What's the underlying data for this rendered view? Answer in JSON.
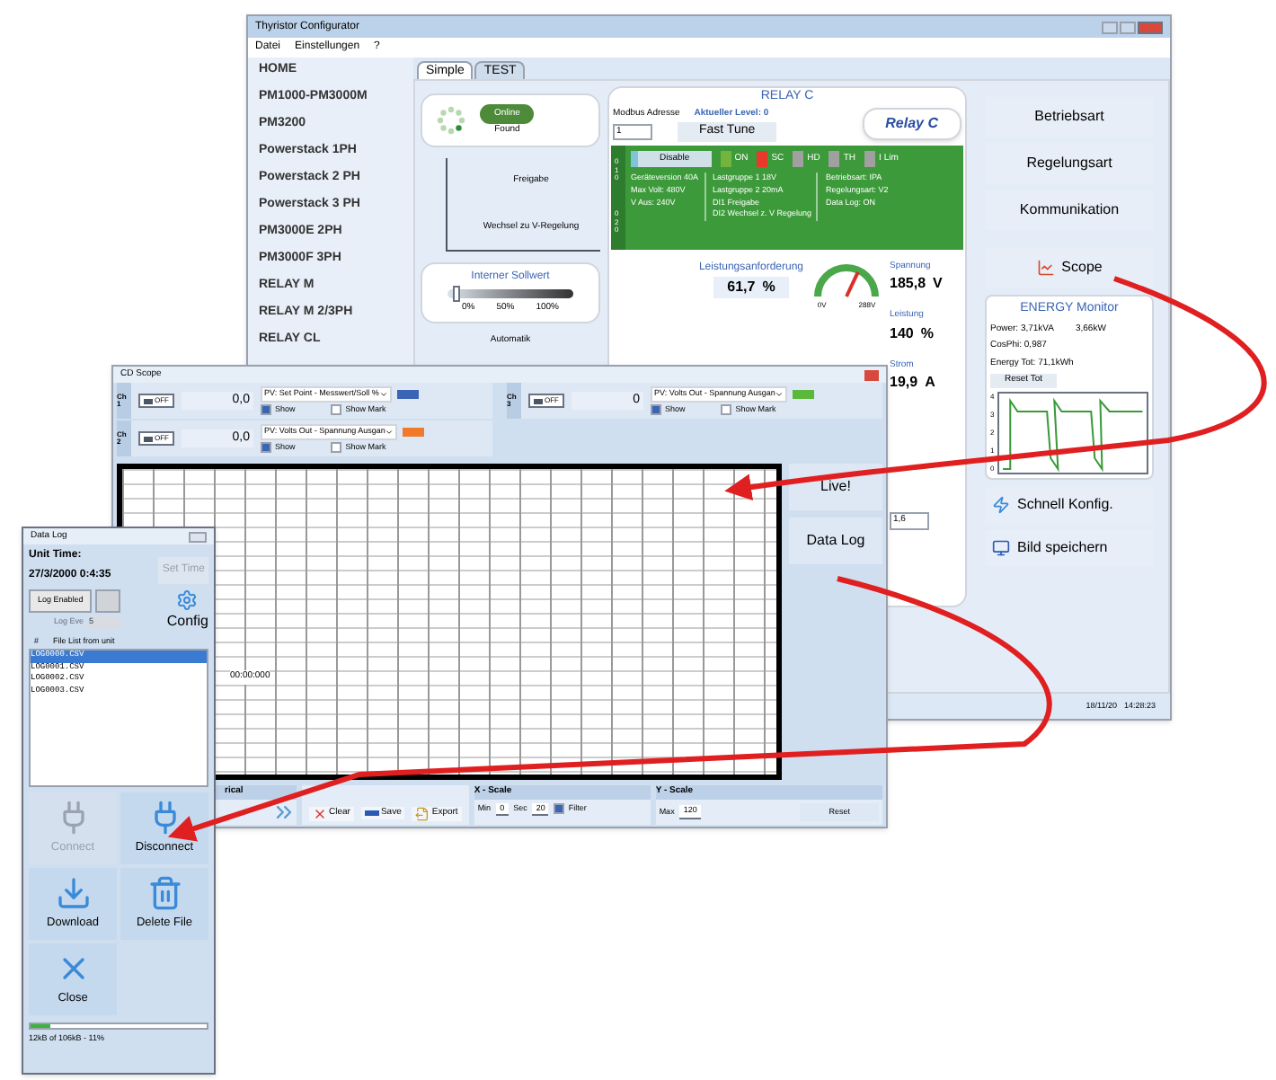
{
  "main_window": {
    "title": "Thyristor Configurator",
    "menu": [
      "Datei",
      "Einstellungen",
      "?"
    ],
    "sidebar": [
      "HOME",
      "PM1000-PM3000M",
      "PM3200",
      "Powerstack 1PH",
      "Powerstack 2 PH",
      "Powerstack 3 PH",
      "PM3000E 2PH",
      "PM3000F 3PH",
      "RELAY M",
      "RELAY M 2/3PH",
      "RELAY CL"
    ],
    "tabs": [
      {
        "label": "Simple",
        "selected": true
      },
      {
        "label": "TEST",
        "selected": false
      }
    ],
    "connection": {
      "label": "Online",
      "caption": "Found"
    },
    "diagram": [
      "Freigabe",
      "Wechsel zu V-Regelung",
      "Automatik"
    ],
    "setpoint": {
      "title": "Interner Sollwert",
      "level": 0.04,
      "ticks": [
        "0%",
        "50%",
        "100%"
      ]
    },
    "relay": {
      "title": "RELAY C",
      "modbus_label": "Modbus Adresse",
      "modbus_value": "1",
      "level_label": "Aktueller Level: 0",
      "tune_button": "Fast Tune",
      "logo": "Relay C",
      "disable_button": "Disable",
      "indicators": [
        {
          "label": "ON",
          "color": "#74b43c"
        },
        {
          "label": "SC",
          "color": "#e8392a"
        },
        {
          "label": "HD",
          "color": "#a0a0a0"
        },
        {
          "label": "TH",
          "color": "#a0a0a0"
        },
        {
          "label": "I Lim",
          "color": "#a0a0a0"
        }
      ],
      "side_tabs": [
        "010",
        "020"
      ],
      "info_columns": [
        [
          "Geräteversion 40A",
          "Max Volt: 480V",
          "V Aus: 240V"
        ],
        [
          "Lastgruppe 1 18V",
          "Lastgruppe 2 20mA",
          "DI1 Freigabe",
          "DI2 Wechsel z. V Regelung"
        ],
        [
          "Betriebsart: IPA",
          "Regelungsart: V2",
          "Data Log: ON"
        ]
      ],
      "demand_label": "Leistungsanforderung",
      "demand_value": "61,7",
      "demand_unit": "%",
      "gauge": {
        "min": "0V",
        "max": "288V",
        "level": 0.64
      },
      "readings": [
        {
          "label": "Spannung",
          "value": "185,8",
          "unit": "V"
        },
        {
          "label": "Leistung",
          "value": "140",
          "unit": "%"
        },
        {
          "label": "Strom",
          "value": "19,9",
          "unit": "A"
        }
      ],
      "spin_value": "1,6"
    },
    "buttons": [
      "Betriebsart",
      "Regelungsart",
      "Kommunikation"
    ],
    "scope_button": "Scope",
    "energy": {
      "title": "ENERGY Monitor",
      "lines": [
        "Power: 3,71kVA",
        "CosPhi: 0,987",
        "Energy Tot: 71,1kWh"
      ],
      "power_kw": "3,66kW",
      "reset_button": "Reset Tot",
      "y_ticks": [
        "4",
        "3",
        "2",
        "1",
        "0"
      ]
    },
    "tools": [
      {
        "label": "Schnell Konfig.",
        "kind": "quick"
      },
      {
        "label": "Bild speichern",
        "kind": "monitor"
      }
    ],
    "status_bar": {
      "date": "18/11/20",
      "time": "14:28:23"
    }
  },
  "scope_window": {
    "title": "CD Scope",
    "channels": [
      {
        "name": "Ch 1",
        "switch": "OFF",
        "on": false,
        "value": "0,0",
        "source": "PV: Set Point - Messwert/Soll %",
        "color": "#3a64b4",
        "show": {
          "label": "Show",
          "checked": true
        },
        "mark": {
          "label": "Show Mark",
          "checked": false
        }
      },
      {
        "name": "Ch 3",
        "switch": "OFF",
        "on": false,
        "value": "0",
        "source": "PV: Volts Out - Spannung Ausgan",
        "color": "#5cb83a",
        "show": {
          "label": "Show",
          "checked": true
        },
        "mark": {
          "label": "Show Mark",
          "checked": false
        }
      },
      {
        "name": "Ch 2",
        "switch": "OFF",
        "on": false,
        "value": "0,0",
        "source": "PV: Volts Out - Spannung Ausgan",
        "color": "#f07a2a",
        "show": {
          "label": "Show",
          "checked": true
        },
        "mark": {
          "label": "Show Mark",
          "checked": false
        }
      }
    ],
    "plot_time": "00:00:000",
    "side_buttons": [
      "Live!",
      "Data Log"
    ],
    "historical_title": "rical",
    "actions": [
      {
        "label": "Clear",
        "kind": "clear"
      },
      {
        "label": "Save",
        "kind": "save"
      },
      {
        "label": "Export",
        "kind": "export"
      }
    ],
    "x_scale": {
      "title": "X - Scale",
      "min_label": "Min",
      "min_value": "0",
      "sec_label": "Sec",
      "sec_value": "20",
      "filter": {
        "label": "Filter",
        "checked": true
      }
    },
    "y_scale": {
      "title": "Y - Scale",
      "max_label": "Max",
      "max_value": "120",
      "reset": "Reset"
    }
  },
  "log_window": {
    "title": "Data Log",
    "unit_time_label": "Unit Time:",
    "unit_time": "27/3/2000 0:4:35",
    "set_time": {
      "label": "Set Time",
      "disabled": true
    },
    "log_enabled": "Log Enabled",
    "log_every_label": "Log Eve",
    "log_every_value": "5",
    "config": "Config",
    "list_header": [
      "#",
      "File List from unit"
    ],
    "files": [
      {
        "name": "LOG0000.CSV",
        "selected": true
      },
      {
        "name": "LOG0001.CSV",
        "selected": false
      },
      {
        "name": "LOG0002.CSV",
        "selected": false
      },
      {
        "name": "LOG0003.CSV",
        "selected": false
      }
    ],
    "buttons": [
      {
        "label": "Connect",
        "kind": "connect",
        "disabled": true
      },
      {
        "label": "Disconnect",
        "kind": "disconnect",
        "disabled": false
      },
      {
        "label": "Download",
        "kind": "download",
        "disabled": false
      },
      {
        "label": "Delete File",
        "kind": "delete",
        "disabled": false
      },
      {
        "label": "Close",
        "kind": "close",
        "disabled": false
      }
    ],
    "progress": {
      "level": 0.11,
      "text": "12kB of 106kB - 11%"
    }
  }
}
